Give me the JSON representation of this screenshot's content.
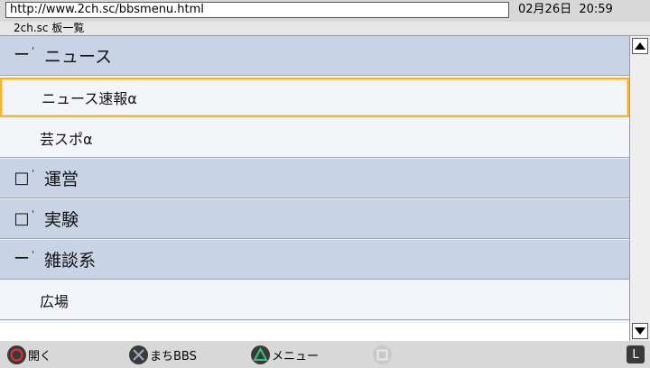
{
  "browser": {
    "url": "http://www.2ch.sc/bbsmenu.html",
    "datetime": "02月26日  20:59"
  },
  "breadcrumb": "2ch.sc  板一覧",
  "list": [
    {
      "type": "category",
      "expanded": true,
      "label": "ニュース"
    },
    {
      "type": "item",
      "label": "ニュース速報α",
      "selected": true
    },
    {
      "type": "item",
      "label": "芸スポα"
    },
    {
      "type": "category",
      "expanded": false,
      "label": "運営"
    },
    {
      "type": "category",
      "expanded": false,
      "label": "実験"
    },
    {
      "type": "category",
      "expanded": true,
      "label": "雑談系"
    },
    {
      "type": "item",
      "label": "広場"
    }
  ],
  "markers": {
    "expanded": "ー",
    "collapsed": "□"
  },
  "controls": {
    "circle": {
      "label": "開く",
      "icon": "circle-button-icon"
    },
    "cross": {
      "label": "まちBBS",
      "icon": "cross-button-icon"
    },
    "triangle": {
      "label": "メニュー",
      "icon": "triangle-button-icon"
    },
    "square": {
      "icon": "square-button-icon",
      "enabled": false
    },
    "l": {
      "icon": "l-button-icon",
      "text": "L"
    }
  },
  "colors": {
    "category_bg": "#c9d3e6",
    "selection_border": "#f2b33a",
    "circle": "#e0333a",
    "cross": "#a0a6c8",
    "triangle": "#3cc083"
  }
}
